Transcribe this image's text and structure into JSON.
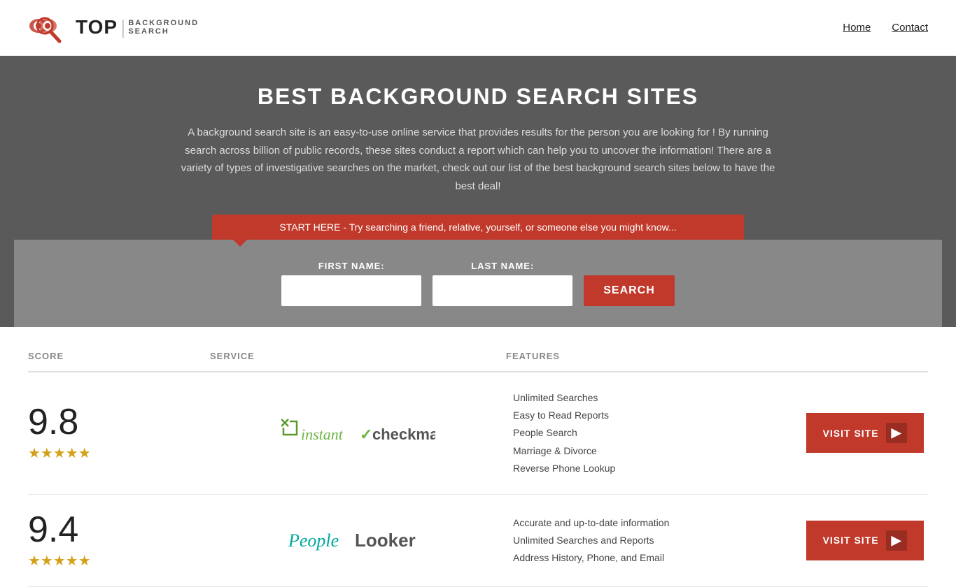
{
  "header": {
    "logo_top": "TOP",
    "logo_bar": "|",
    "logo_sub_line1": "BACKGROUND",
    "logo_sub_line2": "SEARCH",
    "nav_home": "Home",
    "nav_contact": "Contact"
  },
  "hero": {
    "title": "BEST BACKGROUND SEARCH SITES",
    "description": "A background search site is an easy-to-use online service that provides results  for the person you are looking for ! By  running  search across billion of public records, these sites conduct  a report which can help you to uncover the information! There are a variety of types of investigative searches on the market, check out our  list of the best background search sites below to have the best deal!",
    "search_banner": "START HERE - Try searching a friend, relative, yourself, or someone else you might know...",
    "first_name_label": "FIRST NAME:",
    "last_name_label": "LAST NAME:",
    "search_button": "SEARCH"
  },
  "table": {
    "col_score": "SCORE",
    "col_service": "SERVICE",
    "col_features": "FEATURES",
    "col_action": ""
  },
  "listings": [
    {
      "score": "9.8",
      "stars": "★★★★★",
      "stars_count": 4.5,
      "service_name": "instantcheckmate",
      "service_display": "instant checkmate",
      "features": [
        "Unlimited Searches",
        "Easy to Read Reports",
        "People Search",
        "Marriage & Divorce",
        "Reverse Phone Lookup"
      ],
      "visit_label": "VISIT SITE"
    },
    {
      "score": "9.4",
      "stars": "★★★★★",
      "stars_count": 4.5,
      "service_name": "peoplelooker",
      "service_display": "PeopleLooker",
      "features": [
        "Accurate and up-to-date information",
        "Unlimited Searches and Reports",
        "Address History, Phone, and Email"
      ],
      "visit_label": "VISIT SITE"
    }
  ]
}
